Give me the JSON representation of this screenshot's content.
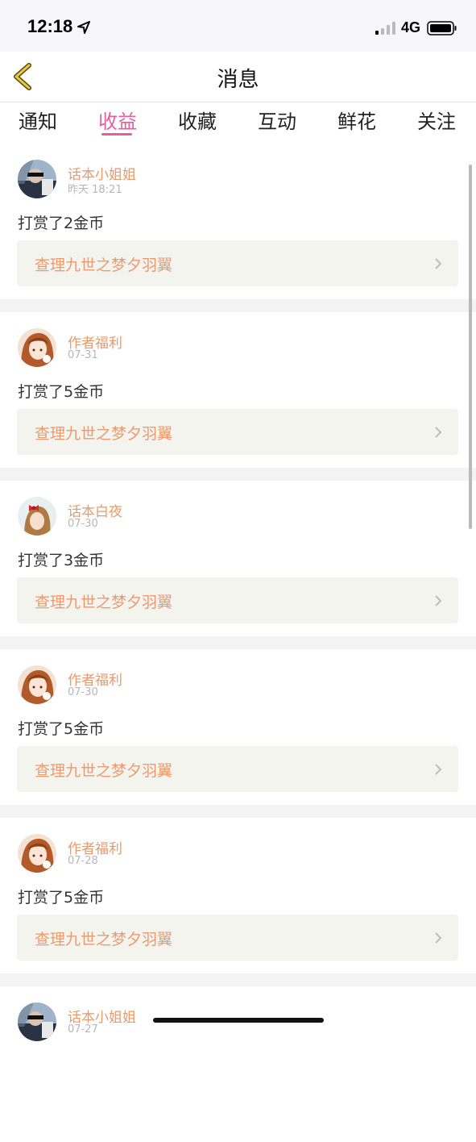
{
  "status_bar": {
    "time": "12:18",
    "network": "4G"
  },
  "nav": {
    "title": "消息"
  },
  "tabs": [
    {
      "label": "通知",
      "active": false
    },
    {
      "label": "收益",
      "active": true
    },
    {
      "label": "收藏",
      "active": false
    },
    {
      "label": "互动",
      "active": false
    },
    {
      "label": "鲜花",
      "active": false
    },
    {
      "label": "关注",
      "active": false
    }
  ],
  "items": [
    {
      "name": "话本小姐姐",
      "date": "昨天 18:21",
      "message": "打赏了2金币",
      "link": "查理九世之梦夕羽翼",
      "avatar": "driver-photo"
    },
    {
      "name": "作者福利",
      "date": "07-31",
      "message": "打赏了5金币",
      "link": "查理九世之梦夕羽翼",
      "avatar": "anime-girl"
    },
    {
      "name": "话本白夜",
      "date": "07-30",
      "message": "打赏了3金币",
      "link": "查理九世之梦夕羽翼",
      "avatar": "girl-red-bow"
    },
    {
      "name": "作者福利",
      "date": "07-30",
      "message": "打赏了5金币",
      "link": "查理九世之梦夕羽翼",
      "avatar": "anime-girl"
    },
    {
      "name": "作者福利",
      "date": "07-28",
      "message": "打赏了5金币",
      "link": "查理九世之梦夕羽翼",
      "avatar": "anime-girl"
    },
    {
      "name": "话本小姐姐",
      "date": "07-27",
      "message": "",
      "link": "",
      "avatar": "driver-photo"
    }
  ],
  "colors": {
    "accent": "#e35fa0",
    "name": "#e79a6b",
    "link": "#ec9a6f",
    "link_bg": "#f4f4ee"
  }
}
